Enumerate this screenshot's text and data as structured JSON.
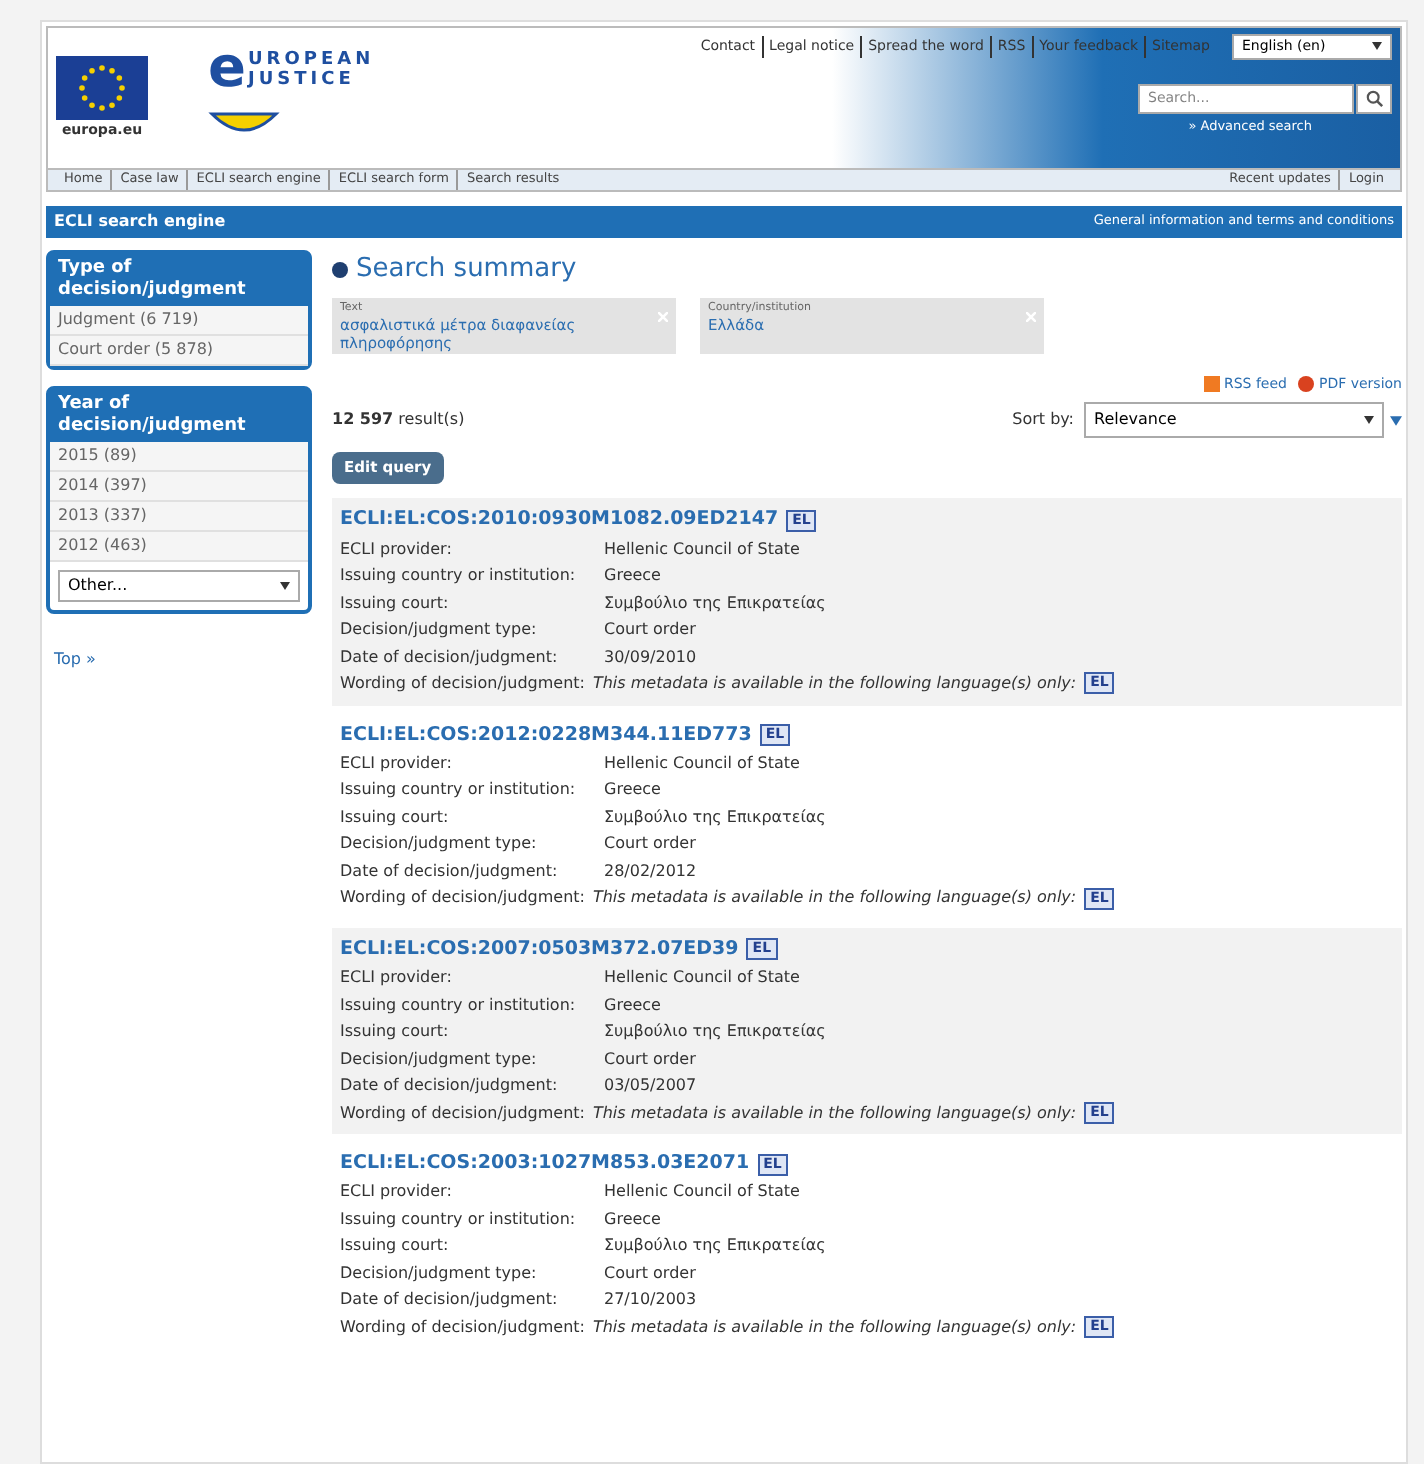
{
  "header": {
    "europa_label": "europa.eu",
    "logo": {
      "letter": "e",
      "line1": "UROPEAN",
      "line2": "JUSTICE"
    },
    "top_links": [
      "Contact",
      "Legal notice",
      "Spread the word",
      "RSS",
      "Your feedback",
      "Sitemap"
    ],
    "language": "English (en)",
    "search": {
      "placeholder": "Search..."
    },
    "advanced_search": "» Advanced search"
  },
  "breadcrumb": [
    "Home",
    "Case law",
    "ECLI search engine",
    "ECLI search form",
    "Search results"
  ],
  "account_links": [
    "Recent updates",
    "Login"
  ],
  "title_bar": {
    "title": "ECLI search engine",
    "link": "General information and terms and conditions"
  },
  "sidebar": {
    "facets": [
      {
        "title": "Type of decision/judgment",
        "items": [
          "Judgment (6 719)",
          "Court order (5 878)"
        ]
      },
      {
        "title": "Year of decision/judgment",
        "items": [
          "2015 (89)",
          "2014 (397)",
          "2013 (337)",
          "2012 (463)"
        ],
        "select": "Other..."
      }
    ],
    "top_link": "Top »"
  },
  "summary": {
    "title": "Search summary",
    "criteria": [
      {
        "label": "Text",
        "value": "ασφαλιστικά μέτρα διαφανείας πληροφόρησης"
      },
      {
        "label": "Country/institution",
        "value": "Ελλάδα"
      }
    ]
  },
  "feeds": [
    "RSS feed",
    "PDF version"
  ],
  "result_count": {
    "number": "12 597",
    "label": "result(s)"
  },
  "edit_button": "Edit query",
  "sort": {
    "label": "Sort by:",
    "value": "Relevance"
  },
  "results": [
    {
      "id": "ECLI:EL:COS:2010:0930M1082.09ED2147",
      "lang": "EL",
      "fields": [
        [
          "ECLI provider:",
          "Hellenic Council of State"
        ],
        [
          "Issuing country or institution:",
          "Greece"
        ],
        [
          "Issuing court:",
          "Συμβούλιο της Επικρατείας"
        ],
        [
          "Decision/judgment type:",
          "Court order"
        ],
        [
          "Date of decision/judgment:",
          "30/09/2010"
        ]
      ],
      "wording_label": "Wording of decision/judgment:",
      "wording": "This metadata is available in the following language(s) only:",
      "wording_lang": "EL"
    },
    {
      "id": "ECLI:EL:COS:2012:0228M344.11ED773",
      "lang": "EL",
      "fields": [
        [
          "ECLI provider:",
          "Hellenic Council of State"
        ],
        [
          "Issuing country or institution:",
          "Greece"
        ],
        [
          "Issuing court:",
          "Συμβούλιο της Επικρατείας"
        ],
        [
          "Decision/judgment type:",
          "Court order"
        ],
        [
          "Date of decision/judgment:",
          "28/02/2012"
        ]
      ],
      "wording_label": "Wording of decision/judgment:",
      "wording": "This metadata is available in the following language(s) only:",
      "wording_lang": "EL"
    },
    {
      "id": "ECLI:EL:COS:2007:0503M372.07ED39",
      "lang": "EL",
      "fields": [
        [
          "ECLI provider:",
          "Hellenic Council of State"
        ],
        [
          "Issuing country or institution:",
          "Greece"
        ],
        [
          "Issuing court:",
          "Συμβούλιο της Επικρατείας"
        ],
        [
          "Decision/judgment type:",
          "Court order"
        ],
        [
          "Date of decision/judgment:",
          "03/05/2007"
        ]
      ],
      "wording_label": "Wording of decision/judgment:",
      "wording": "This metadata is available in the following language(s) only:",
      "wording_lang": "EL"
    },
    {
      "id": "ECLI:EL:COS:2003:1027M853.03E2071",
      "lang": "EL",
      "fields": [
        [
          "ECLI provider:",
          "Hellenic Council of State"
        ],
        [
          "Issuing country or institution:",
          "Greece"
        ],
        [
          "Issuing court:",
          "Συμβούλιο της Επικρατείας"
        ],
        [
          "Decision/judgment type:",
          "Court order"
        ],
        [
          "Date of decision/judgment:",
          "27/10/2003"
        ]
      ],
      "wording_label": "Wording of decision/judgment:",
      "wording": "This metadata is available in the following language(s) only:",
      "wording_lang": "EL"
    }
  ]
}
